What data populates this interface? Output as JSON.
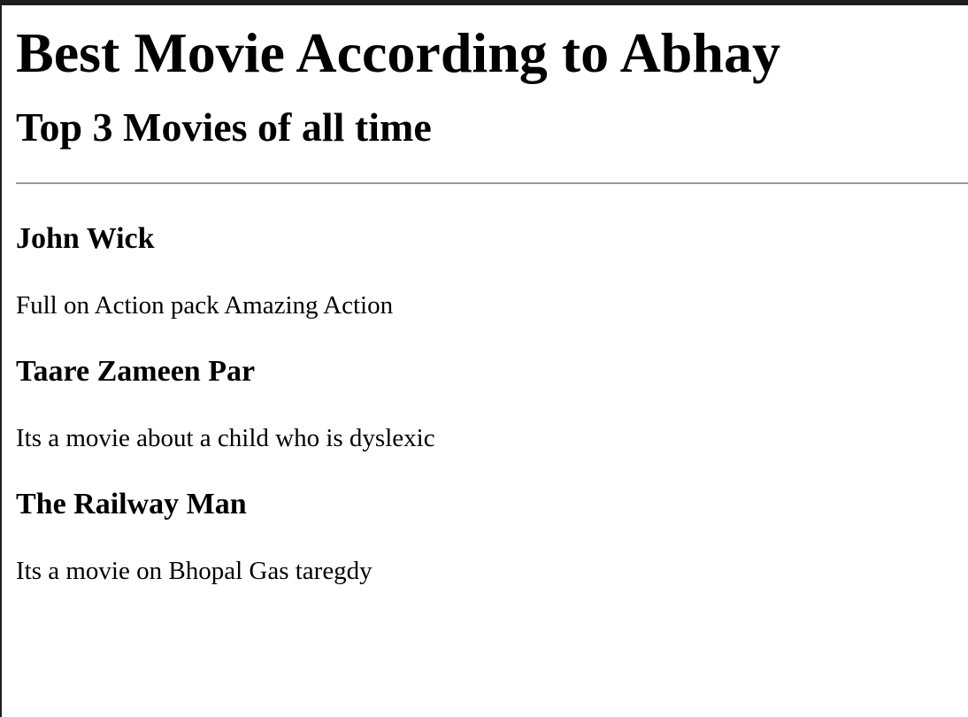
{
  "page": {
    "title": "Best Movie According to Abhay",
    "subtitle": "Top 3 Movies of all time"
  },
  "movies": [
    {
      "title": "John Wick",
      "description": "Full on Action pack Amazing Action"
    },
    {
      "title": "Taare Zameen Par",
      "description": "Its a movie about a child who is dyslexic"
    },
    {
      "title": "The Railway Man",
      "description": "Its a movie on Bhopal Gas taregdy"
    }
  ],
  "colors": {
    "frame": "#1e1e1e",
    "background": "#ffffff",
    "text": "#000000",
    "divider": "#9a9a9a"
  }
}
